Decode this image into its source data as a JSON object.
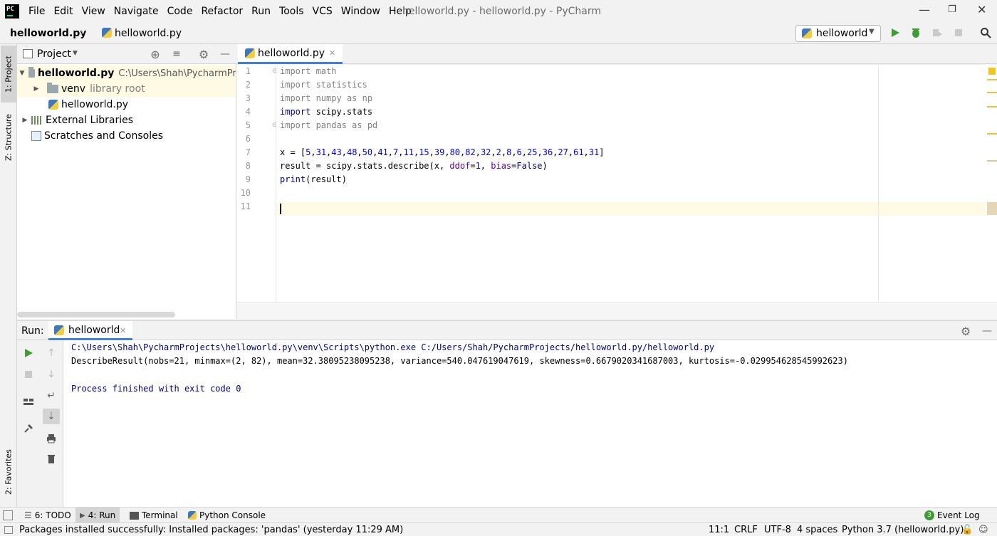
{
  "menu": [
    "File",
    "Edit",
    "View",
    "Navigate",
    "Code",
    "Refactor",
    "Run",
    "Tools",
    "VCS",
    "Window",
    "Help"
  ],
  "window_title": "helloworld.py - helloworld.py - PyCharm",
  "logo_text": "PC",
  "breadcrumb": {
    "project": "helloworld.py",
    "file": "helloworld.py"
  },
  "run_config": "helloworld",
  "left_stripe": {
    "project": "1: Project",
    "structure": "Z: Structure",
    "favorites": "2: Favorites"
  },
  "project_panel": {
    "title": "Project",
    "root_name": "helloworld.py",
    "root_path": "C:\\Users\\Shah\\PycharmProjects\\helloworld.py",
    "venv": "venv",
    "venv_hint": "library root",
    "file": "helloworld.py",
    "external": "External Libraries",
    "scratches": "Scratches and Consoles"
  },
  "editor": {
    "tab": "helloworld.py",
    "line_numbers": [
      "1",
      "2",
      "3",
      "4",
      "5",
      "6",
      "7",
      "8",
      "9",
      "10",
      "11"
    ]
  },
  "code": {
    "l1_kw": "import",
    "l1_mod": " math",
    "l2_kw": "import",
    "l2_mod": " statistics",
    "l3_kw": "import",
    "l3_mod": " numpy ",
    "l3_as": "as",
    "l3_alias": " np",
    "l4_kw": "import",
    "l4_mod": " scipy.stats",
    "l5_kw": "import",
    "l5_mod": " pandas ",
    "l5_as": "as",
    "l5_alias": " pd",
    "l7_pre": "x = [",
    "l7_nums": [
      "5",
      "31",
      "43",
      "48",
      "50",
      "41",
      "7",
      "11",
      "15",
      "39",
      "80",
      "82",
      "32",
      "2",
      "8",
      "6",
      "25",
      "36",
      "27",
      "61",
      "31"
    ],
    "l7_post": "]",
    "l8_a": "result = scipy.stats.describe(x, ",
    "l8_k1": "ddof",
    "l8_eq1": "=",
    "l8_v1": "1",
    "l8_c": ", ",
    "l8_k2": "bias",
    "l8_eq2": "=",
    "l8_v2": "False",
    "l8_end": ")",
    "l9_fn": "print",
    "l9_rest": "(result)"
  },
  "run_panel": {
    "label": "Run:",
    "tab": "helloworld",
    "cmd": "C:\\Users\\Shah\\PycharmProjects\\helloworld.py\\venv\\Scripts\\python.exe C:/Users/Shah/PycharmProjects/helloworld.py/helloworld.py",
    "result": "DescribeResult(nobs=21, minmax=(2, 82), mean=32.38095238095238, variance=540.047619047619, skewness=0.6679020341687003, kurtosis=-0.029954628545992623)",
    "exit": "Process finished with exit code 0"
  },
  "bottom_tabs": {
    "todo": "6: TODO",
    "run": "4: Run",
    "terminal": "Terminal",
    "python_console": "Python Console",
    "event_log": "Event Log",
    "event_count": "3"
  },
  "status": {
    "message": "Packages installed successfully: Installed packages: 'pandas' (yesterday 11:29 AM)",
    "position": "11:1",
    "line_sep": "CRLF",
    "encoding": "UTF-8",
    "indent": "4 spaces",
    "interpreter": "Python 3.7 (helloworld.py)"
  },
  "colors": {
    "accent": "#4083c9",
    "run_green": "#3f9c35",
    "caret_line": "#fffae3",
    "console_cmd": "#000080"
  }
}
